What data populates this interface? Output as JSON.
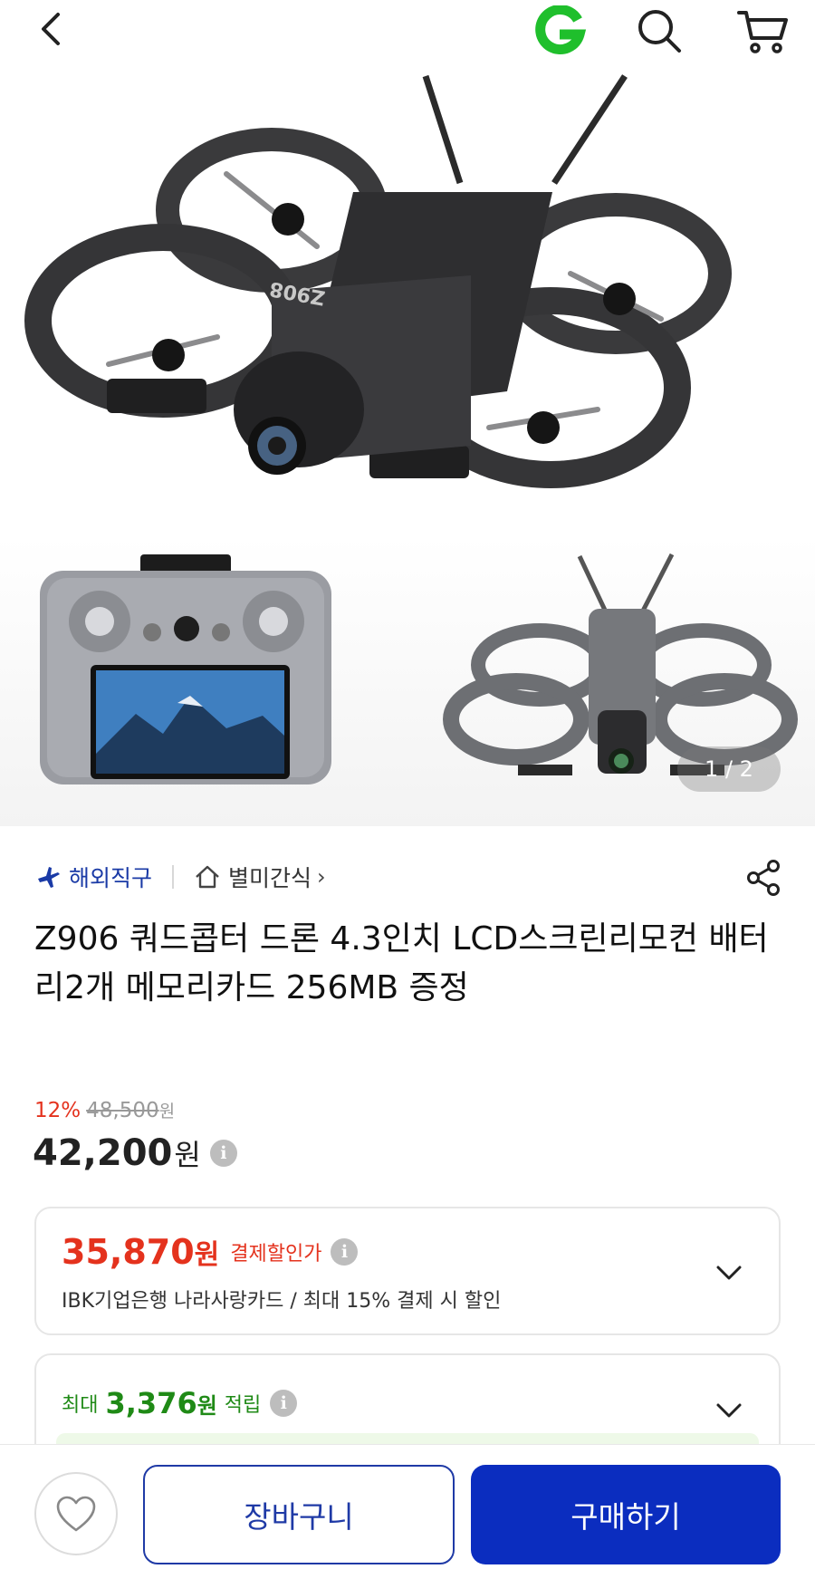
{
  "colors": {
    "brand_blue": "#0b2dbf",
    "discount_red": "#e4321d",
    "points_green": "#1f8a16",
    "g_logo_green": "#1fbf2c"
  },
  "topbar": {
    "icons": [
      "back-icon",
      "gmarket-g-logo-icon",
      "search-icon",
      "cart-icon"
    ]
  },
  "gallery": {
    "page_indicator": "1 / 2",
    "drone_logo_text": "Z908"
  },
  "product": {
    "badge": "해외직구",
    "shop": "별미간식",
    "shop_chevron": "›",
    "title": "Z906 쿼드콥터 드론 4.3인치 LCD스크린리모컨 배터리2개 메모리카드 256MB 증정",
    "discount_rate": "12%",
    "original_price": "48,500",
    "original_unit": "원",
    "price": "42,200",
    "price_unit": "원"
  },
  "payment_discount": {
    "price": "35,870",
    "unit": "원",
    "label": "결제할인가",
    "description": "IBK기업은행 나라사랑카드 / 최대 15% 결제 시 할인"
  },
  "points": {
    "prefix": "최대",
    "amount": "3,376",
    "unit": "원",
    "suffix": "적립"
  },
  "bottom": {
    "cart_label": "장바구니",
    "buy_label": "구매하기"
  },
  "info_glyph": "i"
}
